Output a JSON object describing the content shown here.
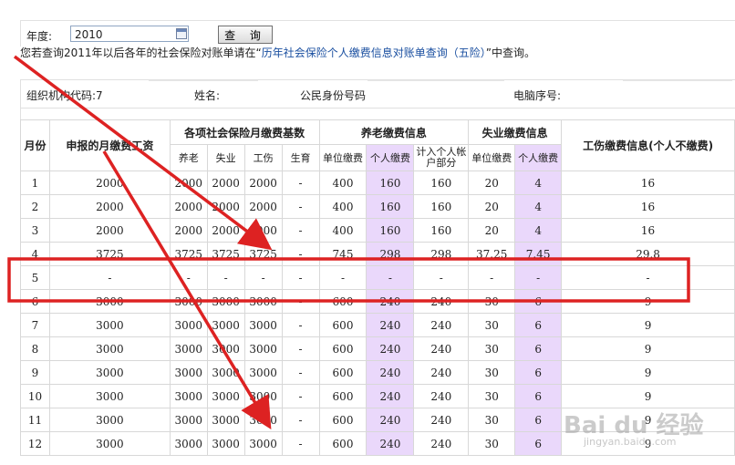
{
  "query": {
    "year_label": "年度:",
    "year_value": "2010",
    "button_label": "查 询"
  },
  "notice": {
    "prefix": "您若查询2011年以后各年的社会保险对账单请在“",
    "link": "历年社会保险个人缴费信息对账单查询（五险）",
    "suffix": "”中查询。"
  },
  "info": {
    "org_code_label": "组织机构代码:",
    "org_code_value": "7",
    "name_label": "姓名:",
    "id_label": "公民身份号码",
    "pc_no_label": "电脑序号:"
  },
  "table": {
    "headers": {
      "month": "月份",
      "salary": "申报的月缴费工资",
      "base_group": "各项社会保险月缴费基数",
      "pension_group": "养老缴费信息",
      "unemp_group": "失业缴费信息",
      "injury": "工伤缴费信息(个人不缴费)",
      "base_pension": "养老",
      "base_unemp": "失业",
      "base_injury": "工伤",
      "base_maternity": "生育",
      "pension_unit": "单位缴费",
      "pension_personal": "个人缴费",
      "pension_account": "计入个人帐户部分",
      "unemp_unit": "单位缴费",
      "unemp_personal": "个人缴费"
    },
    "rows": [
      [
        "1",
        "2000",
        "2000",
        "2000",
        "2000",
        "-",
        "400",
        "160",
        "160",
        "20",
        "4",
        "16"
      ],
      [
        "2",
        "2000",
        "2000",
        "2000",
        "2000",
        "-",
        "400",
        "160",
        "160",
        "20",
        "4",
        "16"
      ],
      [
        "3",
        "2000",
        "2000",
        "2000",
        "2000",
        "-",
        "400",
        "160",
        "160",
        "20",
        "4",
        "16"
      ],
      [
        "4",
        "3725",
        "3725",
        "3725",
        "3725",
        "-",
        "745",
        "298",
        "298",
        "37.25",
        "7.45",
        "29.8"
      ],
      [
        "5",
        "-",
        "-",
        "-",
        "-",
        "-",
        "-",
        "-",
        "-",
        "-",
        "-",
        "-"
      ],
      [
        "6",
        "3000",
        "3000",
        "3000",
        "3000",
        "-",
        "600",
        "240",
        "240",
        "30",
        "6",
        "9"
      ],
      [
        "7",
        "3000",
        "3000",
        "3000",
        "3000",
        "-",
        "600",
        "240",
        "240",
        "30",
        "6",
        "9"
      ],
      [
        "8",
        "3000",
        "3000",
        "3000",
        "3000",
        "-",
        "600",
        "240",
        "240",
        "30",
        "6",
        "9"
      ],
      [
        "9",
        "3000",
        "3000",
        "3000",
        "3000",
        "-",
        "600",
        "240",
        "240",
        "30",
        "6",
        "9"
      ],
      [
        "10",
        "3000",
        "3000",
        "3000",
        "3000",
        "-",
        "600",
        "240",
        "240",
        "30",
        "6",
        "9"
      ],
      [
        "11",
        "3000",
        "3000",
        "3000",
        "3000",
        "-",
        "600",
        "240",
        "240",
        "30",
        "6",
        "9"
      ],
      [
        "12",
        "3000",
        "3000",
        "3000",
        "3000",
        "-",
        "600",
        "240",
        "240",
        "30",
        "6",
        "9"
      ]
    ]
  },
  "annotation": {
    "color": "#dd2222",
    "highlighted_month": "5"
  },
  "watermark": {
    "logo": "Bai du 经验",
    "url": "jingyan.baidu.com"
  },
  "colors": {
    "personal_highlight": "#ead8fb",
    "link": "#1a4fa0"
  }
}
